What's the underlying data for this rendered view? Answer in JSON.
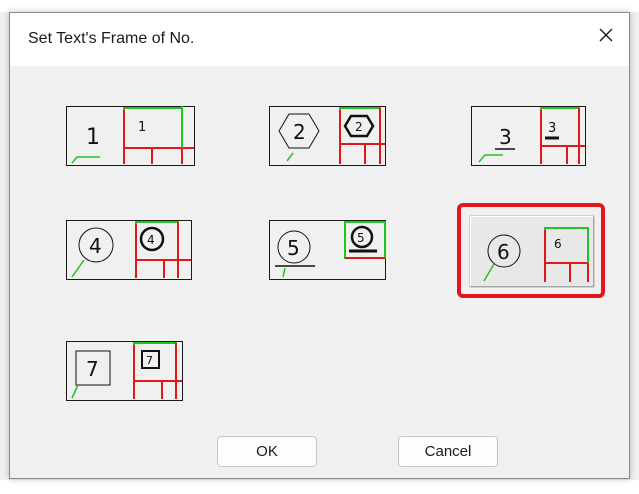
{
  "dialog": {
    "title": "Set Text's Frame of No.",
    "close_icon": "close-icon"
  },
  "options": [
    {
      "label": "1",
      "frame": "underline-leader"
    },
    {
      "label": "2",
      "frame": "hexagon"
    },
    {
      "label": "3",
      "frame": "underline"
    },
    {
      "label": "4",
      "frame": "circle"
    },
    {
      "label": "5",
      "frame": "circle-underline"
    },
    {
      "label": "6",
      "frame": "circle",
      "selected": true
    },
    {
      "label": "7",
      "frame": "square"
    }
  ],
  "buttons": {
    "ok": "OK",
    "cancel": "Cancel"
  },
  "colors": {
    "selection": "#e3161c",
    "guide_green": "#22c322",
    "guide_red": "#e3161c"
  }
}
